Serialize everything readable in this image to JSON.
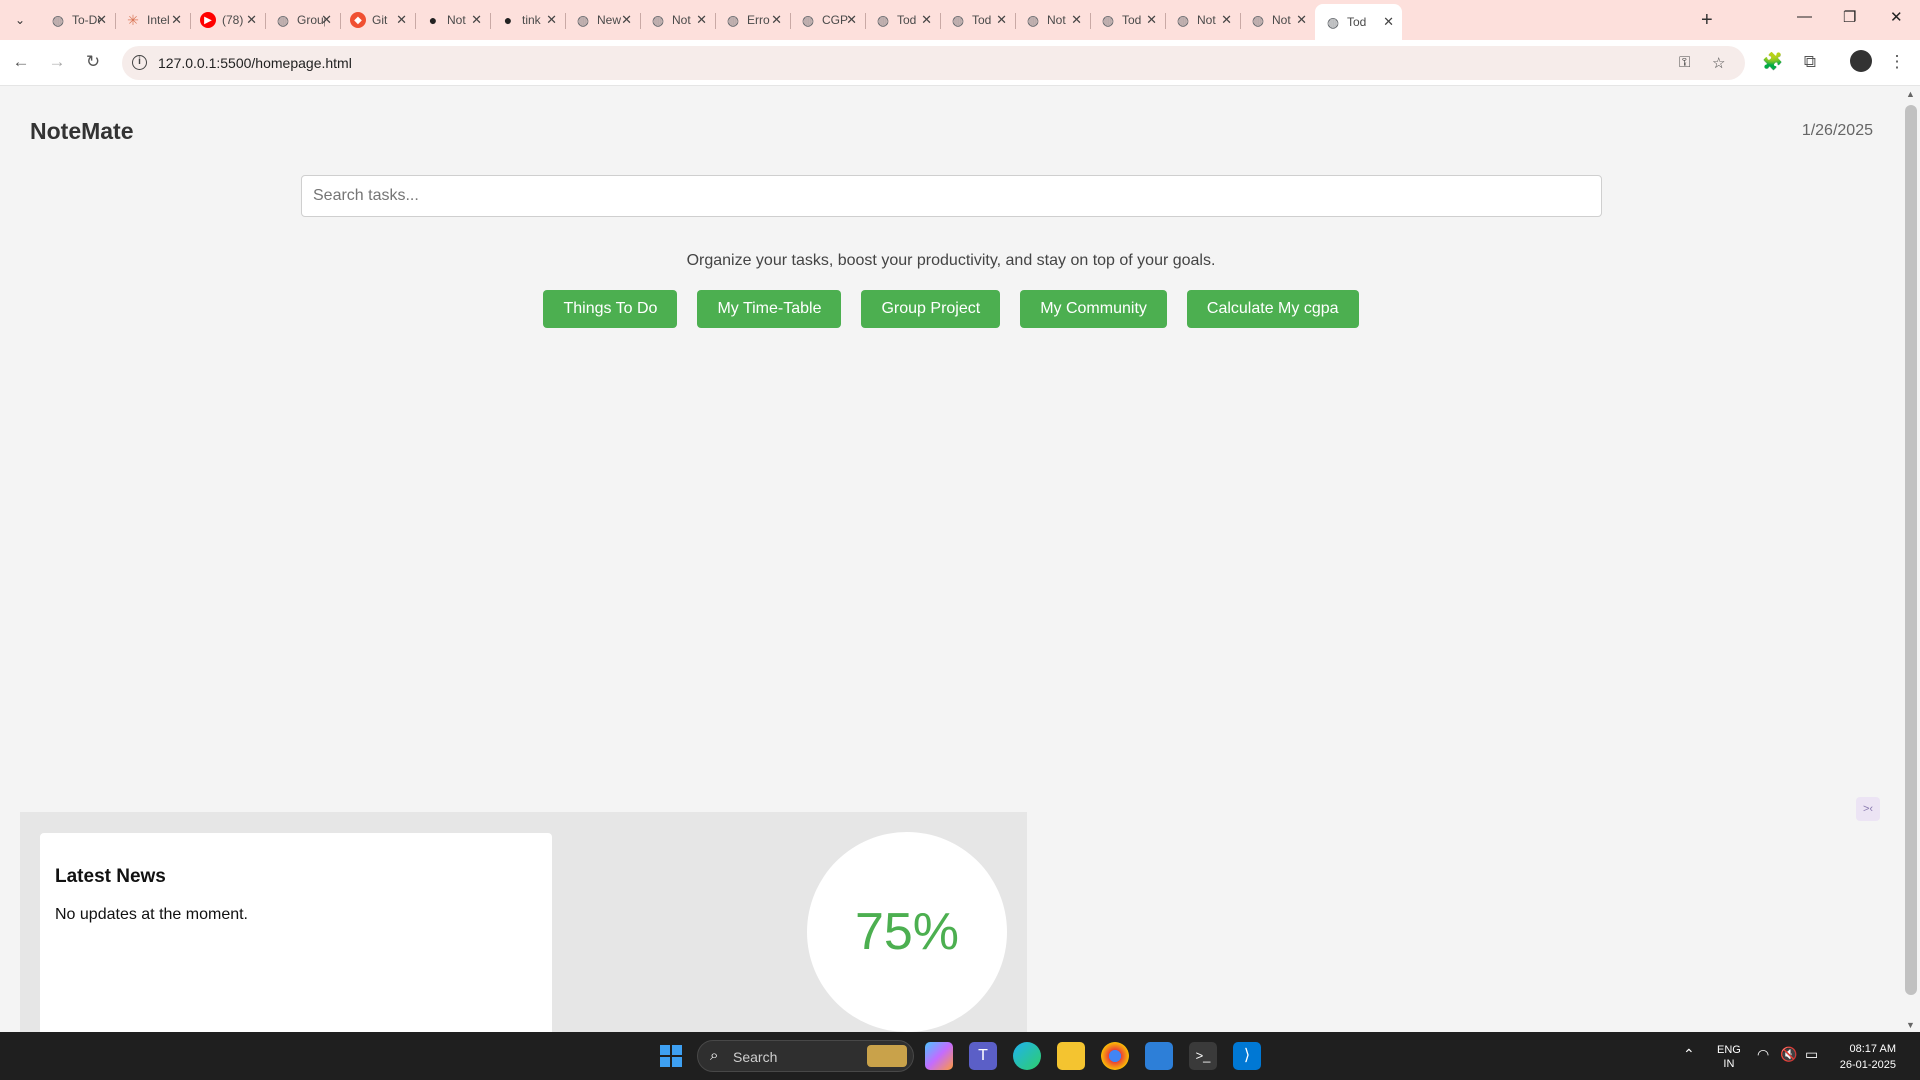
{
  "browser": {
    "tabs": [
      {
        "title": "To-Do",
        "favicon": "globe-icon",
        "color": "#5f6368"
      },
      {
        "title": "Intel",
        "favicon": "claude-icon",
        "color": "#d97757"
      },
      {
        "title": "(78)",
        "favicon": "youtube-icon",
        "color": "#ff0000"
      },
      {
        "title": "Group",
        "favicon": "globe-icon",
        "color": "#5f6368"
      },
      {
        "title": "Git",
        "favicon": "git-icon",
        "color": "#f05032"
      },
      {
        "title": "Not",
        "favicon": "github-icon",
        "color": "#222222"
      },
      {
        "title": "tink",
        "favicon": "github-icon",
        "color": "#222222"
      },
      {
        "title": "New",
        "favicon": "globe-icon",
        "color": "#5f6368"
      },
      {
        "title": "Not",
        "favicon": "globe-icon",
        "color": "#5f6368"
      },
      {
        "title": "Erro",
        "favicon": "globe-icon",
        "color": "#5f6368"
      },
      {
        "title": "CGP",
        "favicon": "globe-icon",
        "color": "#5f6368"
      },
      {
        "title": "Tod",
        "favicon": "globe-icon",
        "color": "#5f6368"
      },
      {
        "title": "Tod",
        "favicon": "globe-icon",
        "color": "#5f6368"
      },
      {
        "title": "Not",
        "favicon": "globe-icon",
        "color": "#5f6368"
      },
      {
        "title": "Tod",
        "favicon": "globe-icon",
        "color": "#5f6368"
      },
      {
        "title": "Not",
        "favicon": "globe-icon",
        "color": "#5f6368"
      },
      {
        "title": "Not",
        "favicon": "globe-icon",
        "color": "#5f6368"
      },
      {
        "title": "Tod",
        "favicon": "globe-icon",
        "color": "#5f6368",
        "active": true
      }
    ],
    "url": "127.0.0.1:5500/homepage.html"
  },
  "page": {
    "brand": "NoteMate",
    "date": "1/26/2025",
    "search_placeholder": "Search tasks...",
    "tagline": "Organize your tasks, boost your productivity, and stay on top of your goals.",
    "buttons": [
      {
        "label": "Things To Do"
      },
      {
        "label": "My Time-Table"
      },
      {
        "label": "Group Project"
      },
      {
        "label": "My Community"
      },
      {
        "label": "Calculate My cgpa"
      }
    ],
    "news": {
      "title": "Latest News",
      "body": "No updates at the moment."
    },
    "progress": {
      "label": "75%",
      "value": 75
    },
    "accent_color": "#4caf50"
  },
  "taskbar": {
    "search_label": "Search",
    "language": "ENG",
    "region": "IN",
    "time": "08:17 AM",
    "date": "26-01-2025"
  }
}
